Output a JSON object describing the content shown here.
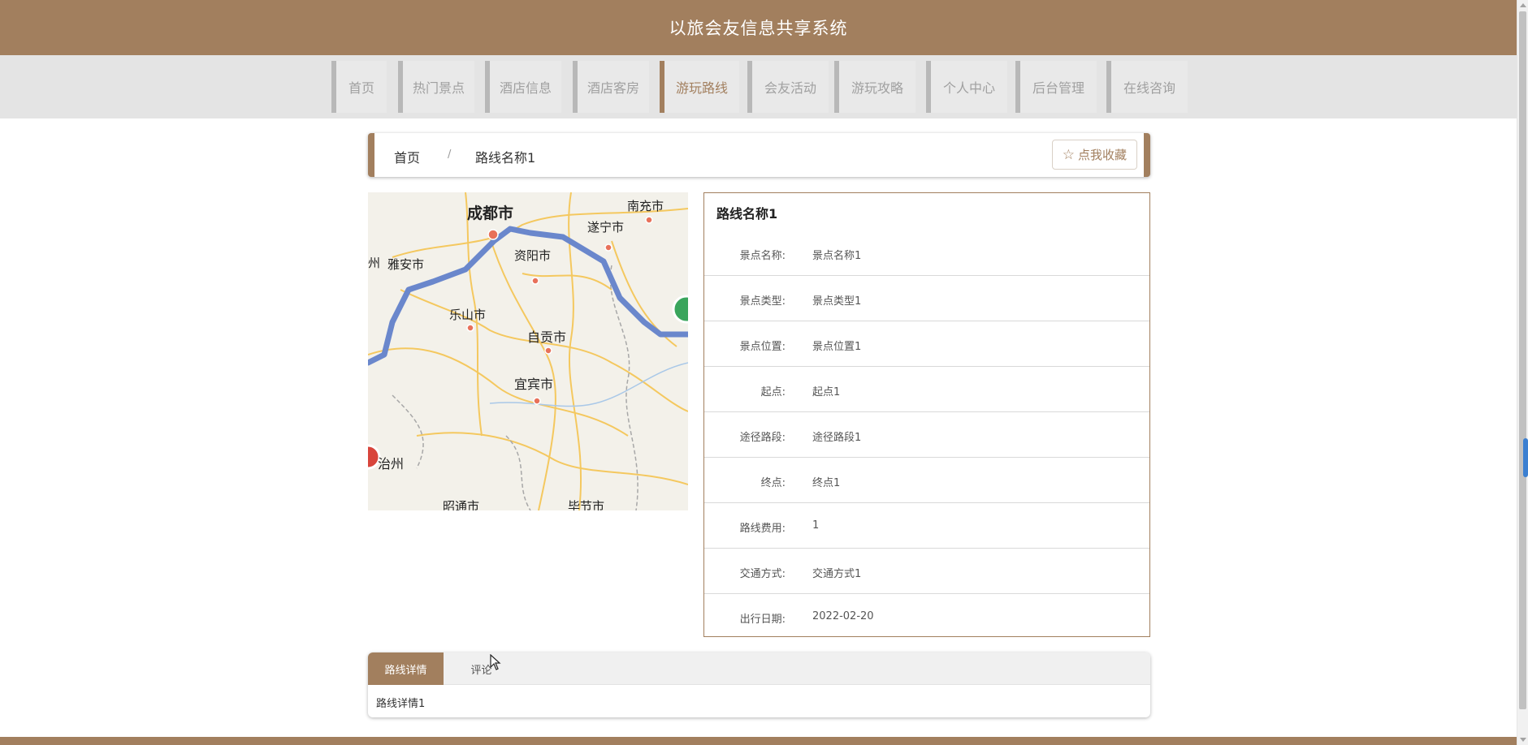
{
  "header": {
    "title": "以旅会友信息共享系统"
  },
  "nav": {
    "items": [
      {
        "label": "首页",
        "active": false
      },
      {
        "label": "热门景点",
        "active": false
      },
      {
        "label": "酒店信息",
        "active": false
      },
      {
        "label": "酒店客房",
        "active": false
      },
      {
        "label": "游玩路线",
        "active": true
      },
      {
        "label": "会友活动",
        "active": false
      },
      {
        "label": "游玩攻略",
        "active": false
      },
      {
        "label": "个人中心",
        "active": false
      },
      {
        "label": "后台管理",
        "active": false
      },
      {
        "label": "在线咨询",
        "active": false
      }
    ]
  },
  "breadcrumb": {
    "home": "首页",
    "separator": "/",
    "current": "路线名称1"
  },
  "favorite_button": {
    "label": "点我收藏",
    "icon": "star-outline-icon"
  },
  "map": {
    "labels": [
      "成都市",
      "南充市",
      "遂宁市",
      "资阳市",
      "雅安市",
      "州",
      "乐山市",
      "自贡市",
      "宜宾市",
      "治州",
      "昭通市",
      "毕节市"
    ]
  },
  "detail": {
    "title": "路线名称1",
    "rows": [
      {
        "label": "景点名称:",
        "value": "景点名称1"
      },
      {
        "label": "景点类型:",
        "value": "景点类型1"
      },
      {
        "label": "景点位置:",
        "value": "景点位置1"
      },
      {
        "label": "起点:",
        "value": "起点1"
      },
      {
        "label": "途径路段:",
        "value": "途径路段1"
      },
      {
        "label": "终点:",
        "value": "终点1"
      },
      {
        "label": "路线费用:",
        "value": "1"
      },
      {
        "label": "交通方式:",
        "value": "交通方式1"
      },
      {
        "label": "出行日期:",
        "value": "2022-02-20"
      }
    ]
  },
  "tabs": {
    "items": [
      {
        "label": "路线详情",
        "active": true
      },
      {
        "label": "评论",
        "active": false
      }
    ],
    "content": "路线详情1"
  },
  "colors": {
    "brand": "#a27f5e",
    "nav_bg": "#e4e4e4",
    "route": "#5b7ec8"
  }
}
